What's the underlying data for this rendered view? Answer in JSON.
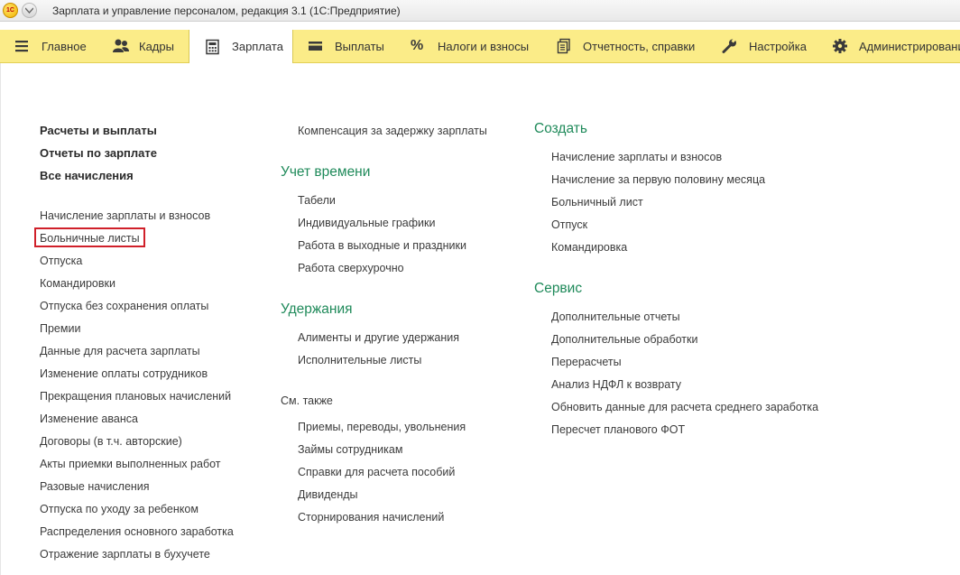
{
  "window": {
    "title": "Зарплата и управление персоналом, редакция 3.1  (1С:Предприятие)",
    "logo_text": "1С"
  },
  "sections": [
    {
      "label": "Главное",
      "icon": "menu-icon"
    },
    {
      "label": "Кадры",
      "icon": "people-icon"
    },
    {
      "label": "Зарплата",
      "icon": "calculator-icon",
      "active": true
    },
    {
      "label": "Выплаты",
      "icon": "wallet-icon"
    },
    {
      "label": "Налоги и взносы",
      "icon": "percent-icon"
    },
    {
      "label": "Отчетность, справки",
      "icon": "reports-icon"
    },
    {
      "label": "Настройка",
      "icon": "wrench-icon"
    },
    {
      "label": "Администрирование",
      "icon": "gear-icon"
    }
  ],
  "col1": {
    "important": [
      "Расчеты и выплаты",
      "Отчеты по зарплате",
      "Все начисления"
    ],
    "items": [
      "Начисление зарплаты и взносов",
      "Больничные листы",
      "Отпуска",
      "Командировки",
      "Отпуска без сохранения оплаты",
      "Премии",
      "Данные для расчета зарплаты",
      "Изменение оплаты сотрудников",
      "Прекращения плановых начислений",
      "Изменение аванса",
      "Договоры (в т.ч. авторские)",
      "Акты приемки выполненных работ",
      "Разовые начисления",
      "Отпуска по уходу за ребенком",
      "Распределения основного заработка",
      "Отражение зарплаты в бухучете"
    ],
    "highlighted_item": "Больничные листы"
  },
  "col2": {
    "top_item": "Компенсация за задержку зарплаты",
    "time_group": {
      "title": "Учет времени",
      "items": [
        "Табели",
        "Индивидуальные графики",
        "Работа в выходные и праздники",
        "Работа сверхурочно"
      ]
    },
    "deductions_group": {
      "title": "Удержания",
      "items": [
        "Алименты и другие удержания",
        "Исполнительные листы"
      ]
    },
    "see_also": {
      "title": "См. также",
      "items": [
        "Приемы, переводы, увольнения",
        "Займы сотрудникам",
        "Справки для расчета пособий",
        "Дивиденды",
        "Сторнирования начислений"
      ]
    }
  },
  "col3": {
    "create_group": {
      "title": "Создать",
      "items": [
        "Начисление зарплаты и взносов",
        "Начисление за первую половину месяца",
        "Больничный лист",
        "Отпуск",
        "Командировка"
      ]
    },
    "service_group": {
      "title": "Сервис",
      "items": [
        "Дополнительные отчеты",
        "Дополнительные обработки",
        "Перерасчеты",
        "Анализ НДФЛ к возврату",
        "Обновить данные для расчета среднего заработка",
        "Пересчет планового ФОТ"
      ]
    }
  },
  "colors": {
    "section_panel": "#fbec88",
    "group_title": "#1f8a5a",
    "highlight": "#d0202a"
  }
}
